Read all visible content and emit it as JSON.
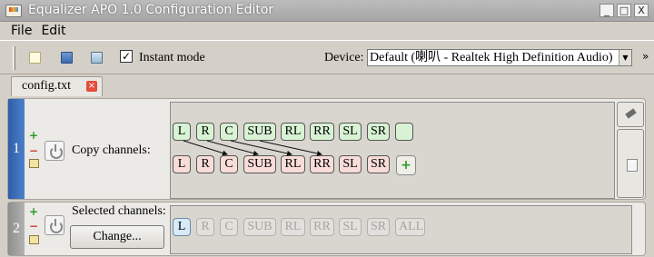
{
  "window": {
    "title": "Equalizer APO 1.0 Configuration Editor",
    "buttons": {
      "minimize": "_",
      "maximize": "□",
      "close": "X"
    }
  },
  "menu": [
    "File",
    "Edit"
  ],
  "toolbar": {
    "instant_mode_label": "Instant mode",
    "instant_mode_checked": "✓",
    "device_label": "Device:",
    "device_value": "Default (喇叭 - Realtek High Definition Audio)",
    "more": "»"
  },
  "tabs": [
    {
      "label": "config.txt",
      "close": "×"
    }
  ],
  "filters": [
    {
      "number": "1",
      "label": "Copy channels:",
      "source_channels": [
        "L",
        "R",
        "C",
        "SUB",
        "RL",
        "RR",
        "SL",
        "SR",
        ""
      ],
      "target_channels": [
        "L",
        "R",
        "C",
        "SUB",
        "RL",
        "RR",
        "SL",
        "SR"
      ],
      "add_symbol": "+",
      "copy_mappings": [
        {
          "from": "L",
          "to": "C"
        },
        {
          "from": "R",
          "to": "SUB"
        },
        {
          "from": "C",
          "to": "RL"
        },
        {
          "from": "SUB",
          "to": "RR"
        }
      ]
    },
    {
      "number": "2",
      "label": "Selected channels:",
      "button_label": "Change...",
      "channels": [
        "L",
        "R",
        "C",
        "SUB",
        "RL",
        "RR",
        "SL",
        "SR",
        "ALL"
      ],
      "selected": [
        "L"
      ]
    }
  ],
  "icons": {
    "add": "plus-icon",
    "remove": "minus-icon",
    "edit": "edit-icon",
    "power": "power-icon"
  }
}
